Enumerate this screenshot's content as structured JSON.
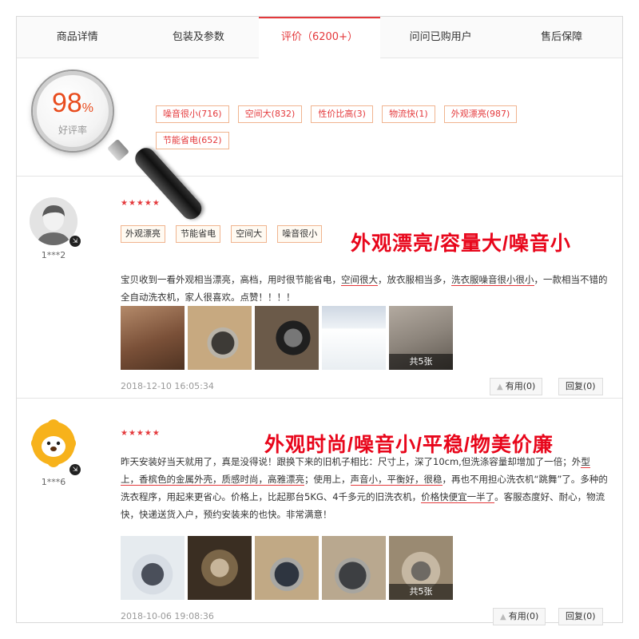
{
  "tabs": [
    {
      "label": "商品详情"
    },
    {
      "label": "包装及参数"
    },
    {
      "label": "评价（6200+）"
    },
    {
      "label": "问问已购用户"
    },
    {
      "label": "售后保障"
    }
  ],
  "active_tab": 2,
  "summary": {
    "rate_value": "98",
    "rate_unit": "%",
    "rate_label": "好评率",
    "tags": [
      "噪音很小(716)",
      "空间大(832)",
      "性价比高(3)",
      "物流快(1)",
      "外观漂亮(987)",
      "节能省电(652)"
    ]
  },
  "reviews": [
    {
      "username": "1***2",
      "stars": "★★★★★",
      "rating": 5,
      "tags": [
        "外观漂亮",
        "节能省电",
        "空间大",
        "噪音很小"
      ],
      "headline": "外观漂亮/容量大/噪音小",
      "content_parts": [
        "宝贝收到一看外观相当漂亮，高档，用时很节能省电，",
        "空间很大",
        "，放衣服相当多，",
        "洗衣服噪音很小很小",
        "，一款相当不错的全自动洗衣机，家人很喜欢。点赞！！！！"
      ],
      "photo_more_label": "共5张",
      "date": "2018-12-10 16:05:34",
      "useful_label": "有用(0)",
      "reply_label": "回复(0)"
    },
    {
      "username": "1***6",
      "stars": "★★★★★",
      "rating": 5,
      "headline": "外观时尚/噪音小/平稳/物美价廉",
      "content_parts": [
        "昨天安装好当天就用了，真是没得说！跟换下来的旧机子相比：尺寸上，深了10cm,但洗涤容量却增加了一倍；外",
        "型上，香槟色的金属外壳，质感时尚，高雅漂亮",
        "；使用上，",
        "声音小，平衡好，很稳",
        "，再也不用担心洗衣机“跳舞”了。多种的洗衣程序，用起来更省心。价格上，比起那台5KG、4千多元的旧洗衣机，",
        "价格快便宜一半了",
        "。客服态度好、耐心，物流快，快递送货入户，预约安装来的也快。非常满意！"
      ],
      "photo_more_label": "共5张",
      "date": "2018-10-06 19:08:36",
      "useful_label": "有用(0)",
      "reply_label": "回复(0)"
    }
  ],
  "colors": {
    "accent": "#e4393c",
    "headline": "#e8061b",
    "rate": "#e84c1e",
    "tag_border": "#f0b48f"
  },
  "icons": [
    "magnifier-icon",
    "thumb-up-icon",
    "user-badge-icon"
  ]
}
